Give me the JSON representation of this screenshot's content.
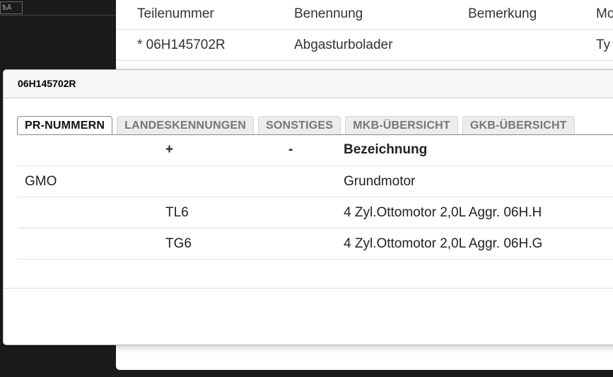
{
  "background": {
    "corner_glyph": "ѢA",
    "parts_table": {
      "headers": [
        "Teilenummer",
        "Benennung",
        "Bemerkung",
        "Mo"
      ],
      "rows": [
        [
          "* 06H145702R",
          "Abgasturbolader",
          "",
          "Ty"
        ]
      ]
    }
  },
  "modal": {
    "title": "06H145702R",
    "tabs": [
      {
        "label": "PR-NUMMERN",
        "active": true
      },
      {
        "label": "LANDESKENNUNGEN",
        "active": false
      },
      {
        "label": "SONSTIGES",
        "active": false
      },
      {
        "label": "MKB-ÜBERSICHT",
        "active": false
      },
      {
        "label": "GKB-ÜBERSICHT",
        "active": false
      }
    ],
    "table": {
      "headers": [
        "",
        "+",
        "-",
        "Bezeichnung"
      ],
      "rows": [
        [
          "GMO",
          "",
          "",
          "Grundmotor"
        ],
        [
          "",
          "TL6",
          "",
          "4 Zyl.Ottomotor 2,0L Aggr. 06H.H"
        ],
        [
          "",
          "TG6",
          "",
          "4 Zyl.Ottomotor 2,0L Aggr. 06H.G"
        ]
      ]
    }
  }
}
